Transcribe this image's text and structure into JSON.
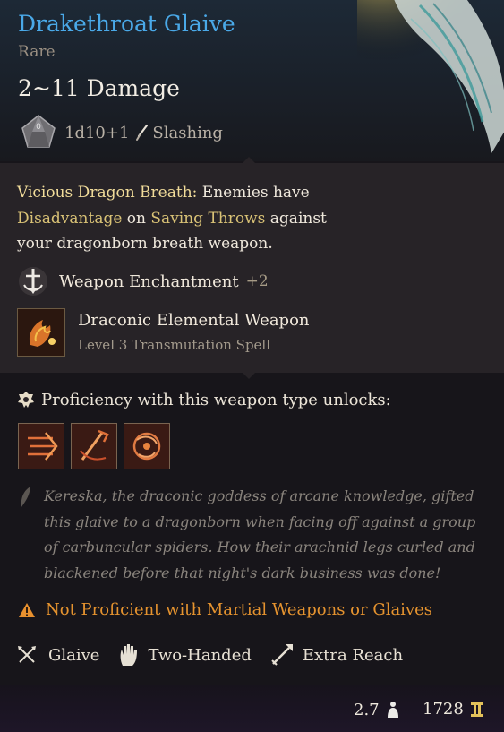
{
  "item": {
    "name": "Drakethroat Glaive",
    "rarity": "Rare",
    "damage": "2~11 Damage",
    "dice": "1d10+1",
    "damage_type": "Slashing",
    "name_color": "#4aa9e8"
  },
  "ability": {
    "name": "Vicious Dragon Breath:",
    "text_a": " Enemies have",
    "term_disadvantage": "Disadvantage",
    "text_b": " on ",
    "term_saving_throws": "Saving Throws",
    "text_c": " against",
    "text_d": "your dragonborn breath weapon."
  },
  "enchantment": {
    "label": "Weapon Enchantment",
    "value": "+2"
  },
  "spell": {
    "name": "Draconic Elemental Weapon",
    "subtitle": "Level 3 Transmutation Spell"
  },
  "proficiency": {
    "heading": "Proficiency with this weapon type unlocks:",
    "unlock_icons": [
      "lacerate-icon",
      "weakening-strike-icon",
      "prepare-icon"
    ]
  },
  "lore": "Kereska, the draconic goddess of arcane knowledge, gifted this glaive to a dragonborn when facing off against a group of carbuncular spiders. How their arachnid legs curled and blackened before that night's dark business was done!",
  "warning": {
    "not_proficient": "Not Proficient",
    "rest": " with Martial Weapons or Glaives"
  },
  "traits": [
    "Glaive",
    "Two-Handed",
    "Extra Reach"
  ],
  "footer": {
    "weight": "2.7",
    "price": "1728"
  }
}
